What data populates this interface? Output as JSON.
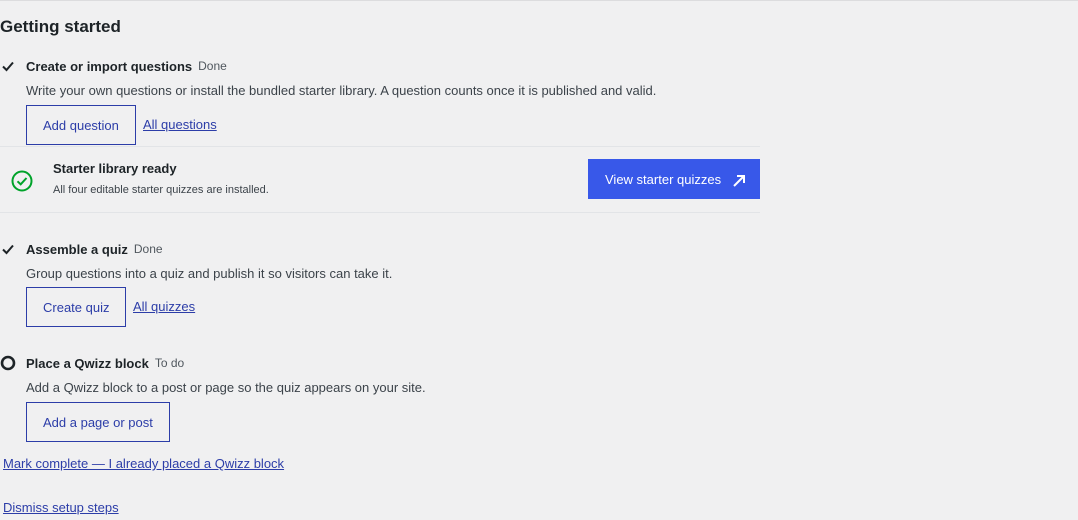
{
  "heading": "Getting started",
  "steps": [
    {
      "title": "Create or import questions",
      "status": "Done",
      "description": "Write your own questions or install the bundled starter library. A question counts once it is published and valid.",
      "button": "Add question",
      "link": "All questions"
    },
    {
      "title": "Assemble a quiz",
      "status": "Done",
      "description": "Group questions into a quiz and publish it so visitors can take it.",
      "button": "Create quiz",
      "link": "All quizzes"
    },
    {
      "title": "Place a Qwizz block",
      "status": "To do",
      "description": "Add a Qwizz block to a post or page so the quiz appears on your site.",
      "button": "Add a page or post"
    }
  ],
  "starter": {
    "title": "Starter library ready",
    "description": "All four editable starter quizzes are installed.",
    "button": "View starter quizzes"
  },
  "mark_complete": "Mark complete — I already placed a Qwizz block",
  "dismiss": "Dismiss setup steps",
  "colors": {
    "accent": "#3858e9",
    "link": "#2c3da8",
    "success": "#00a32a"
  }
}
